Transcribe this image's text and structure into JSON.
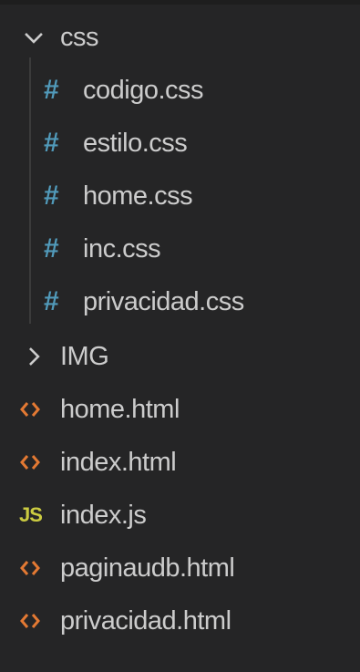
{
  "explorer": {
    "folder_css": {
      "label": "css",
      "icon": "chevron-down-icon"
    },
    "css_files": [
      {
        "label": "codigo.css",
        "icon": "hash-icon"
      },
      {
        "label": "estilo.css",
        "icon": "hash-icon"
      },
      {
        "label": "home.css",
        "icon": "hash-icon"
      },
      {
        "label": "inc.css",
        "icon": "hash-icon"
      },
      {
        "label": "privacidad.css",
        "icon": "hash-icon"
      }
    ],
    "folder_img": {
      "label": "IMG",
      "icon": "chevron-right-icon"
    },
    "root_files": [
      {
        "label": "home.html",
        "icon": "html-icon"
      },
      {
        "label": "index.html",
        "icon": "html-icon"
      },
      {
        "label": "index.js",
        "icon": "js-icon",
        "badge": "JS"
      },
      {
        "label": "paginaudb.html",
        "icon": "html-icon"
      },
      {
        "label": "privacidad.html",
        "icon": "html-icon"
      }
    ]
  },
  "colors": {
    "background": "#252526",
    "text": "#cccccc",
    "css_icon": "#519aba",
    "html_icon": "#e37933",
    "js_icon": "#cbcb41"
  }
}
